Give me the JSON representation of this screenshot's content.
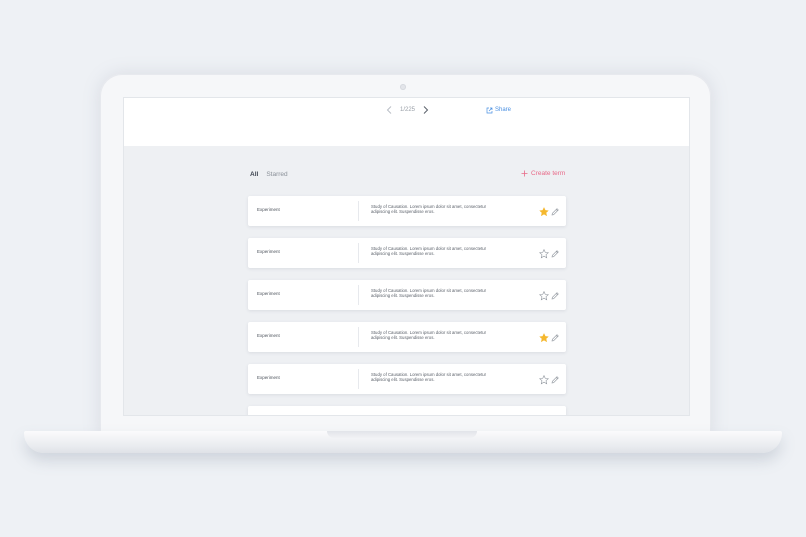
{
  "header": {
    "page_indicator": "1/225",
    "share_label": "Share"
  },
  "filters": {
    "all": "All",
    "starred": "Starred"
  },
  "create_term_label": "Create term",
  "colors": {
    "accent_pink": "#e86a88",
    "link_blue": "#4a90e2",
    "star_gold": "#f5b82e"
  },
  "terms": [
    {
      "name": "Experiment",
      "description": "Study of Causation. Lorem ipsum dolor sit amet, consectetur adipiscing elit. Suspendisse eros.",
      "starred": true
    },
    {
      "name": "Experiment",
      "description": "Study of Causation. Lorem ipsum dolor sit amet, consectetur adipiscing elit. Suspendisse eros.",
      "starred": false
    },
    {
      "name": "Experiment",
      "description": "Study of Causation. Lorem ipsum dolor sit amet, consectetur adipiscing elit. Suspendisse eros.",
      "starred": false
    },
    {
      "name": "Experiment",
      "description": "Study of Causation. Lorem ipsum dolor sit amet, consectetur adipiscing elit. Suspendisse eros.",
      "starred": true
    },
    {
      "name": "Experiment",
      "description": "Study of Causation. Lorem ipsum dolor sit amet, consectetur adipiscing elit. Suspendisse eros.",
      "starred": false
    }
  ]
}
